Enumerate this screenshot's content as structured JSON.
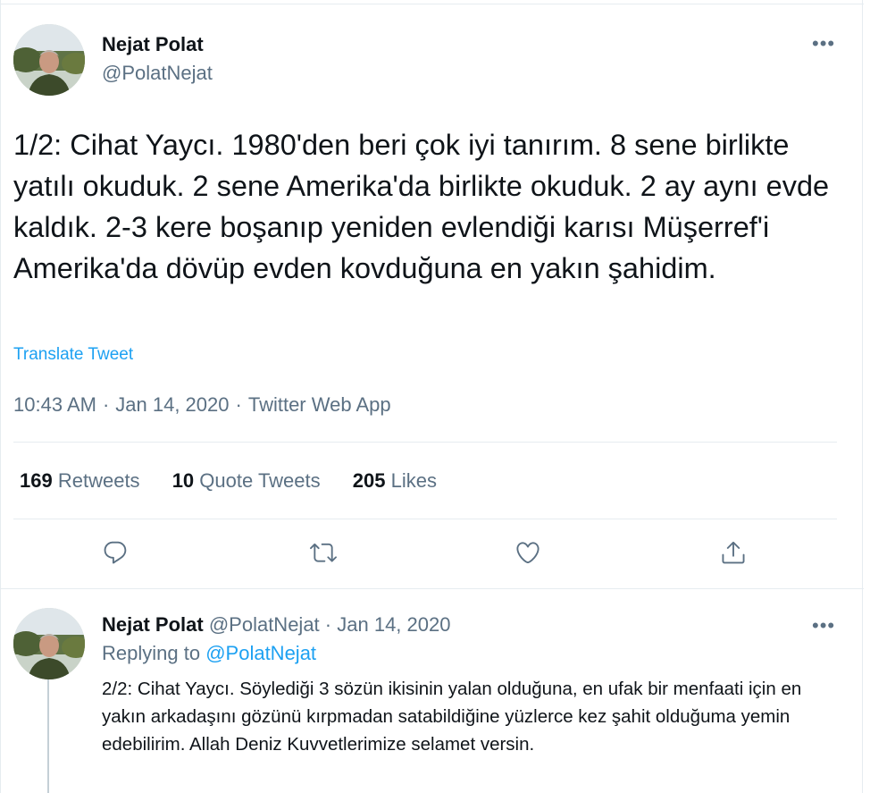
{
  "main_tweet": {
    "author_name": "Nejat Polat",
    "author_handle": "@PolatNejat",
    "more_label": "•••",
    "text": "1/2: Cihat Yaycı. 1980'den beri çok iyi tanırım. 8 sene birlikte yatılı okuduk. 2 sene Amerika'da birlikte okuduk. 2 ay aynı evde kaldık. 2-3 kere boşanıp yeniden evlendiği karısı Müşerref'i Amerika'da dövüp evden kovduğuna en yakın şahidim.",
    "translate_label": "Translate Tweet",
    "time": "10:43 AM",
    "separator": "·",
    "date": "Jan 14, 2020",
    "source": "Twitter Web App",
    "stats": {
      "retweets_count": "169",
      "retweets_label": "Retweets",
      "quote_count": "10",
      "quote_label": "Quote Tweets",
      "likes_count": "205",
      "likes_label": "Likes"
    },
    "actions": [
      "reply-icon",
      "retweet-icon",
      "like-icon",
      "share-icon"
    ]
  },
  "reply_tweet": {
    "author_name": "Nejat Polat",
    "author_handle": "@PolatNejat",
    "separator": "·",
    "date": "Jan 14, 2020",
    "more_label": "•••",
    "replying_prefix": "Replying to",
    "replying_mention": "@PolatNejat",
    "text": "2/2: Cihat Yaycı. Söylediği 3 sözün ikisinin yalan olduğuna, en ufak bir menfaati için en yakın arkadaşını gözünü kırpmadan satabildiğine yüzlerce kez şahit olduğuma yemin edebilirim. Allah Deniz Kuvvetlerimize selamet versin."
  },
  "colors": {
    "text": "#0f1419",
    "secondary": "#5b7083",
    "accent": "#1da1f2",
    "divider": "#e6ecf0"
  }
}
